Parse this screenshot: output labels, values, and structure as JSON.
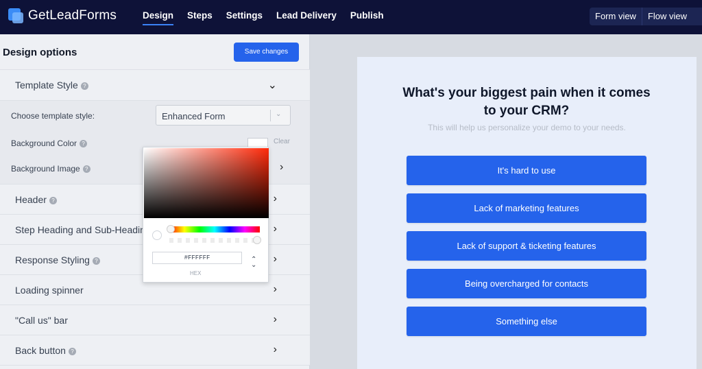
{
  "app": {
    "name": "GetLeadForms",
    "nav": [
      "Design",
      "Steps",
      "Settings",
      "Lead Delivery",
      "Publish"
    ],
    "active_nav": "Design",
    "views": [
      "Form view",
      "Flow view"
    ]
  },
  "left_panel": {
    "title": "Design options",
    "save_label": "Save changes",
    "template_style": {
      "label": "Template Style",
      "choose_label": "Choose template style:",
      "selected": "Enhanced Form",
      "bg_color_label": "Background Color",
      "clear_label": "Clear",
      "bg_image_label": "Background Image"
    },
    "sections": [
      "Header",
      "Step Heading and Sub-Heading",
      "Response Styling",
      "Loading spinner",
      "\"Call us\" bar",
      "Back button"
    ]
  },
  "color_picker": {
    "hex_value": "#FFFFFF",
    "hex_label": "HEX",
    "hue_color": "#ff2a0a"
  },
  "preview": {
    "question": "What's your biggest pain when it comes to your CRM?",
    "subtitle": "This will help us personalize your demo to your needs.",
    "options": [
      "It's hard to use",
      "Lack of marketing features",
      "Lack of support & ticketing features",
      "Being overcharged for contacts",
      "Something else"
    ],
    "accent": "#2563eb"
  }
}
